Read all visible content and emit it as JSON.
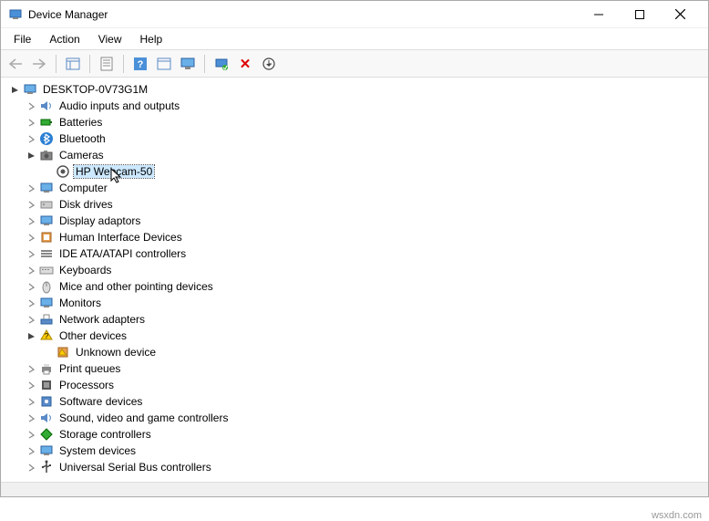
{
  "window": {
    "title": "Device Manager"
  },
  "menu": [
    "File",
    "Action",
    "View",
    "Help"
  ],
  "toolbar": {
    "back": "←",
    "forward": "→",
    "show_hidden": "▭",
    "properties": "▦",
    "help": "?",
    "uninstall": "▭",
    "monitor": "🖵",
    "scan": "scan",
    "delete": "✕",
    "update": "⟳"
  },
  "tree": {
    "root": {
      "label": "DESKTOP-0V73G1M",
      "icon": "🖥"
    },
    "nodes": [
      {
        "label": "Audio inputs and outputs",
        "icon": "🔊",
        "indent": 1,
        "arrow": ">"
      },
      {
        "label": "Batteries",
        "icon": "🔋",
        "indent": 1,
        "arrow": ">"
      },
      {
        "label": "Bluetooth",
        "icon": "bt",
        "indent": 1,
        "arrow": ">"
      },
      {
        "label": "Cameras",
        "icon": "📷",
        "indent": 1,
        "arrow": "v",
        "expanded": true
      },
      {
        "label": "HP Webcam-50",
        "icon": "◉",
        "indent": 2,
        "arrow": "",
        "selected": true
      },
      {
        "label": "Computer",
        "icon": "🖥",
        "indent": 1,
        "arrow": ">"
      },
      {
        "label": "Disk drives",
        "icon": "💽",
        "indent": 1,
        "arrow": ">"
      },
      {
        "label": "Display adaptors",
        "icon": "🖥",
        "indent": 1,
        "arrow": ">"
      },
      {
        "label": "Human Interface Devices",
        "icon": "dev",
        "indent": 1,
        "arrow": ">"
      },
      {
        "label": "IDE ATA/ATAPI controllers",
        "icon": "≡",
        "indent": 1,
        "arrow": ">"
      },
      {
        "label": "Keyboards",
        "icon": "⌨",
        "indent": 1,
        "arrow": ">"
      },
      {
        "label": "Mice and other pointing devices",
        "icon": "🖱",
        "indent": 1,
        "arrow": ">"
      },
      {
        "label": "Monitors",
        "icon": "🖥",
        "indent": 1,
        "arrow": ">"
      },
      {
        "label": "Network adapters",
        "icon": "net",
        "indent": 1,
        "arrow": ">"
      },
      {
        "label": "Other devices",
        "icon": "?",
        "indent": 1,
        "arrow": "v",
        "expanded": true
      },
      {
        "label": "Unknown device",
        "icon": "⚠",
        "indent": 2,
        "arrow": ""
      },
      {
        "label": "Print queues",
        "icon": "🖨",
        "indent": 1,
        "arrow": ">"
      },
      {
        "label": "Processors",
        "icon": "▦",
        "indent": 1,
        "arrow": ">"
      },
      {
        "label": "Software devices",
        "icon": "sw",
        "indent": 1,
        "arrow": ">"
      },
      {
        "label": "Sound, video and game controllers",
        "icon": "🔊",
        "indent": 1,
        "arrow": ">"
      },
      {
        "label": "Storage controllers",
        "icon": "◆",
        "indent": 1,
        "arrow": ">"
      },
      {
        "label": "System devices",
        "icon": "🖥",
        "indent": 1,
        "arrow": ">"
      },
      {
        "label": "Universal Serial Bus controllers",
        "icon": "usb",
        "indent": 1,
        "arrow": ">"
      }
    ]
  },
  "footer": "wsxdn.com"
}
